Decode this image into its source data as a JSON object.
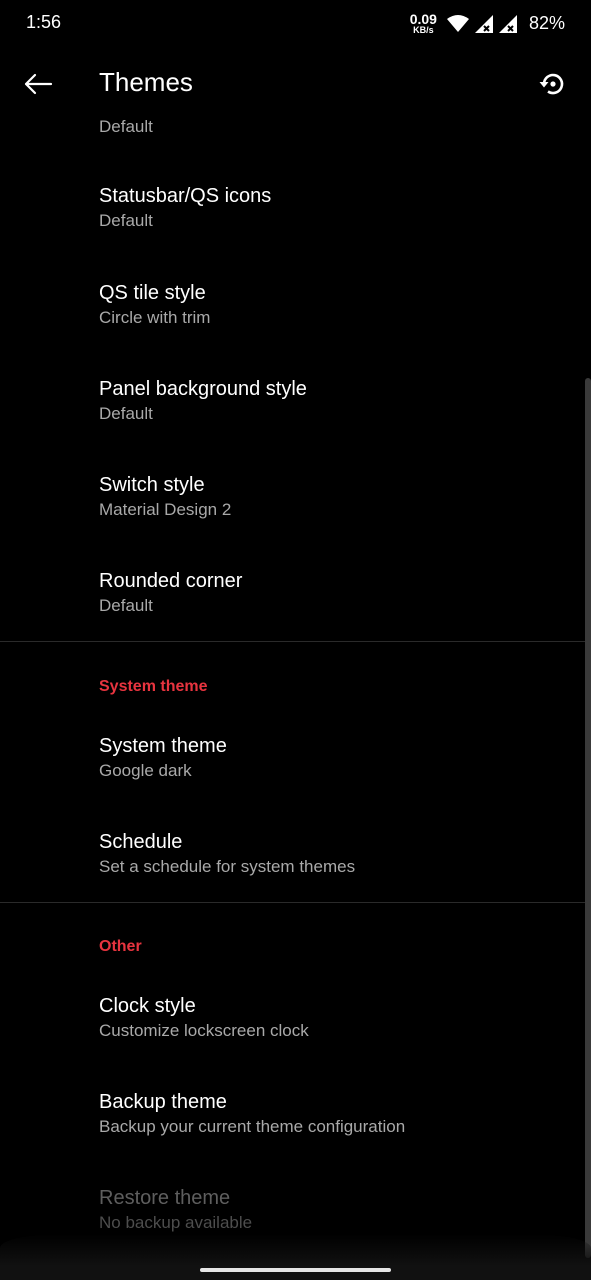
{
  "statusbar": {
    "time": "1:56",
    "speed_value": "0.09",
    "speed_unit": "KB/s",
    "battery": "82%"
  },
  "appbar": {
    "title": "Themes"
  },
  "colors": {
    "background": "#000000",
    "accent": "#e8343f",
    "primary_text": "#ffffff",
    "secondary_text": "#a9a9a9"
  },
  "list": {
    "partial_summary": "Default",
    "items": [
      {
        "title": "Statusbar/QS icons",
        "summary": "Default"
      },
      {
        "title": "QS tile style",
        "summary": "Circle with trim"
      },
      {
        "title": "Panel background style",
        "summary": "Default"
      },
      {
        "title": "Switch style",
        "summary": "Material Design 2"
      },
      {
        "title": "Rounded corner",
        "summary": "Default"
      }
    ],
    "sections": [
      {
        "header": "System theme",
        "items": [
          {
            "title": "System theme",
            "summary": "Google dark"
          },
          {
            "title": "Schedule",
            "summary": "Set a schedule for system themes"
          }
        ]
      },
      {
        "header": "Other",
        "items": [
          {
            "title": "Clock style",
            "summary": "Customize lockscreen clock"
          },
          {
            "title": "Backup theme",
            "summary": "Backup your current theme configuration"
          },
          {
            "title": "Restore theme",
            "summary": "No backup available",
            "enabled": false
          }
        ]
      }
    ]
  }
}
